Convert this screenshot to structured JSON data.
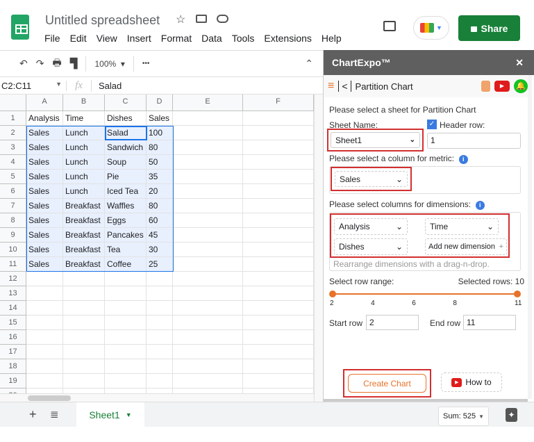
{
  "app": {
    "title": "Untitled spreadsheet",
    "menu": [
      "File",
      "Edit",
      "View",
      "Insert",
      "Format",
      "Data",
      "Tools",
      "Extensions",
      "Help"
    ],
    "share_label": "Share",
    "accent": "#188038"
  },
  "toolbar": {
    "zoom": "100%",
    "more": "•••"
  },
  "formula_bar": {
    "name_box": "C2:C11",
    "fx": "fx",
    "value": "Salad"
  },
  "sheet": {
    "columns": [
      "A",
      "B",
      "C",
      "D",
      "E",
      "F"
    ],
    "row_count": 20,
    "rows": [
      [
        "Analysis",
        "Time",
        "Dishes",
        "Sales"
      ],
      [
        "Sales",
        "Lunch",
        "Salad",
        "100"
      ],
      [
        "Sales",
        "Lunch",
        "Sandwich",
        "80"
      ],
      [
        "Sales",
        "Lunch",
        "Soup",
        "50"
      ],
      [
        "Sales",
        "Lunch",
        "Pie",
        "35"
      ],
      [
        "Sales",
        "Lunch",
        "Iced Tea",
        "20"
      ],
      [
        "Sales",
        "Breakfast",
        "Waffles",
        "80"
      ],
      [
        "Sales",
        "Breakfast",
        "Eggs",
        "60"
      ],
      [
        "Sales",
        "Breakfast",
        "Pancakes",
        "45"
      ],
      [
        "Sales",
        "Breakfast",
        "Tea",
        "30"
      ],
      [
        "Sales",
        "Breakfast",
        "Coffee",
        "25"
      ]
    ]
  },
  "tabs": {
    "sheet1": "Sheet1",
    "sum": "Sum: 525"
  },
  "panel": {
    "title": "ChartExpo™",
    "close": "✕",
    "chart_name": "Partition Chart",
    "select_sheet_prompt": "Please select a sheet for Partition Chart",
    "sheet_name_label": "Sheet Name:",
    "sheet_name_value": "Sheet1",
    "header_row_label": "Header row:",
    "header_row_checked": true,
    "header_row_value": "1",
    "metric_prompt": "Please select a column for metric:",
    "metric_value": "Sales",
    "dimensions_prompt": "Please select columns for dimensions:",
    "dimensions": [
      "Analysis",
      "Time",
      "Dishes"
    ],
    "add_dimension": "Add new dimension",
    "rearrange_hint": "Rearrange dimensions with a drag-n-drop.",
    "row_range_label": "Select row range:",
    "selected_rows": "Selected rows: 10",
    "slider_ticks": [
      "2",
      "4",
      "6",
      "8",
      "11"
    ],
    "slider_range": [
      2,
      11
    ],
    "start_row_label": "Start row",
    "start_row": "2",
    "end_row_label": "End row",
    "end_row": "11",
    "create_chart": "Create Chart",
    "how_to": "How to",
    "accent": "#e8722a"
  }
}
